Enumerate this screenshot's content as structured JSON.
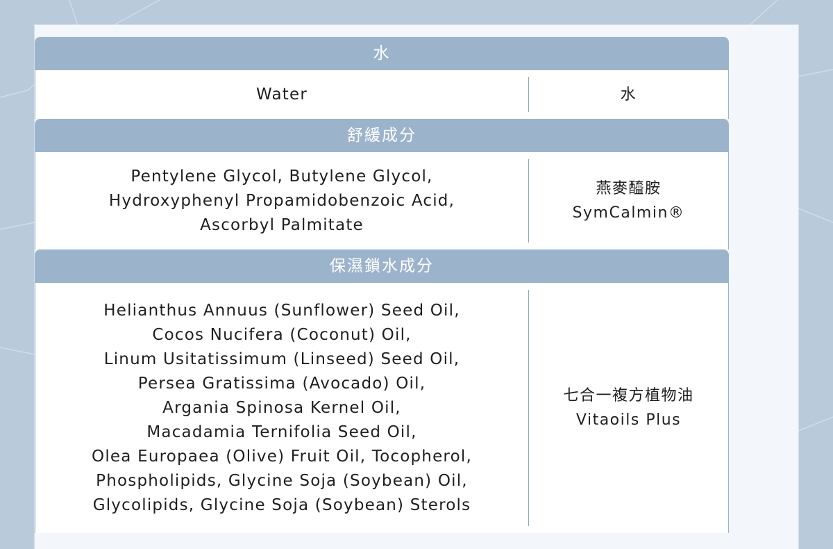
{
  "colors": {
    "background": "#b9cadb",
    "card": "#f3f7fb",
    "header": "#9cb3cc",
    "divider": "#8ea7c2",
    "text": "#1f1f1f"
  },
  "sections": [
    {
      "header": "水",
      "left_lines": [
        "Water"
      ],
      "right_lines": [
        "水"
      ]
    },
    {
      "header": "舒緩成分",
      "left_lines": [
        "Pentylene Glycol, Butylene Glycol,",
        "Hydroxyphenyl Propamidobenzoic Acid,",
        "Ascorbyl Palmitate"
      ],
      "right_lines": [
        "燕麥醯胺",
        "SymCalmin®"
      ]
    },
    {
      "header": "保濕鎖水成分",
      "left_lines": [
        "Helianthus Annuus (Sunflower) Seed Oil,",
        "Cocos Nucifera (Coconut) Oil,",
        "Linum Usitatissimum (Linseed) Seed Oil,",
        "Persea Gratissima (Avocado) Oil,",
        "Argania Spinosa Kernel Oil,",
        "Macadamia Ternifolia Seed Oil,",
        "Olea Europaea (Olive) Fruit Oil, Tocopherol,",
        "Phospholipids, Glycine Soja (Soybean) Oil,",
        "Glycolipids, Glycine Soja (Soybean) Sterols"
      ],
      "right_lines": [
        "七合一複方植物油",
        "Vitaoils Plus"
      ]
    }
  ]
}
